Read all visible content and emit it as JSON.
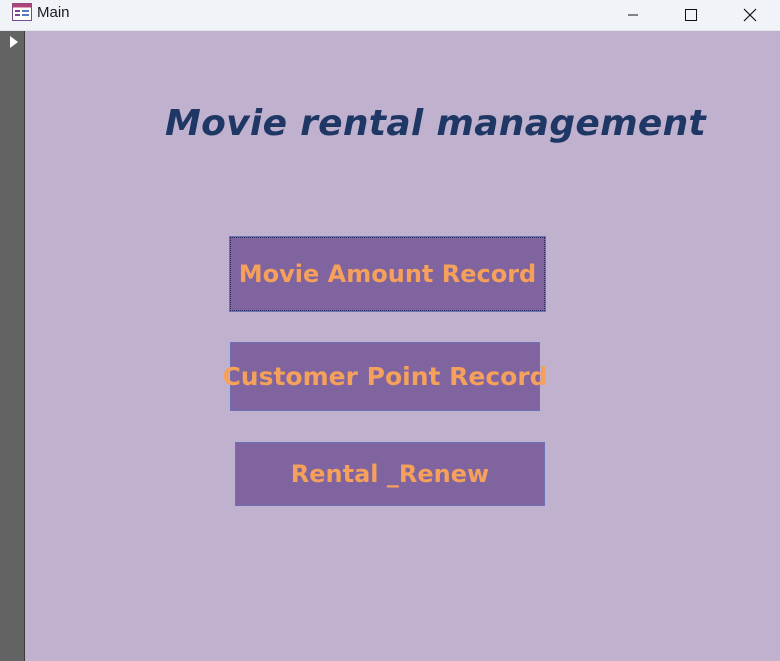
{
  "window": {
    "title": "Main",
    "controls": {
      "minimize": "minimize-icon",
      "maximize": "maximize-icon",
      "close": "close-icon"
    }
  },
  "form": {
    "title": "Movie rental management",
    "buttons": [
      {
        "label": "Movie Amount Record"
      },
      {
        "label": "Customer Point Record"
      },
      {
        "label": "Rental _Renew"
      }
    ]
  },
  "colors": {
    "form_background": "#c0b2cf",
    "title_text": "#1f3764",
    "button_background": "#80649f",
    "button_text": "#f5a05b",
    "record_selector": "#636363"
  }
}
